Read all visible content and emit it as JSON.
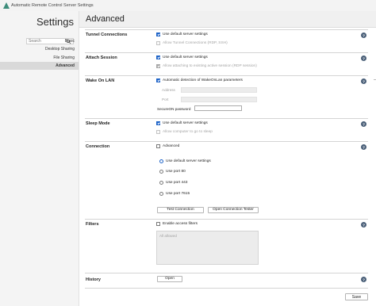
{
  "window": {
    "title": "Automatic Remote Control Server Settings"
  },
  "sidebar": {
    "heading": "Settings",
    "search": {
      "placeholder": "Search",
      "value": ""
    },
    "items": [
      {
        "label": "Basic"
      },
      {
        "label": "Desktop Sharing"
      },
      {
        "label": "File Sharing"
      },
      {
        "label": "Advanced",
        "active": true
      }
    ]
  },
  "main": {
    "title": "Advanced",
    "tunnel": {
      "label": "Tunnel Connections",
      "use_default": {
        "label": "Use default server settings",
        "checked": true
      },
      "allow_tunnel": {
        "label": "Allow Tunnel Connections (RDP, SSH)",
        "checked": false,
        "disabled": true
      }
    },
    "attach": {
      "label": "Attach Session",
      "use_default": {
        "label": "Use default server settings",
        "checked": true
      },
      "allow_attach": {
        "label": "Allow attaching to existing active session (RDP session)",
        "checked": true,
        "disabled": true
      }
    },
    "wol": {
      "label": "Wake On LAN",
      "auto_detect": {
        "label": "Automatic detection of WakeOnLan parameters",
        "checked": true
      },
      "address_label": "Address",
      "address_value": "",
      "port_label": "Port",
      "port_value": "",
      "secureon_label": "SecureON password",
      "secureon_value": ""
    },
    "sleep": {
      "label": "Sleep Mode",
      "use_default": {
        "label": "Use default server settings",
        "checked": true
      },
      "allow_sleep": {
        "label": "Allow computer to go to sleep",
        "checked": false,
        "disabled": true
      }
    },
    "connection": {
      "label": "Connection",
      "advanced": {
        "label": "Advanced",
        "checked": false
      },
      "options": [
        {
          "label": "Use default server settings",
          "selected": true
        },
        {
          "label": "Use port 80",
          "selected": false
        },
        {
          "label": "Use port 443",
          "selected": false
        },
        {
          "label": "Use port 7615",
          "selected": false
        }
      ],
      "test_button": "Test Connection",
      "open_tester_button": "Open Connection Tester"
    },
    "filters": {
      "label": "Filters",
      "enable": {
        "label": "Enable access filters",
        "checked": false
      },
      "list_placeholder": "All allowed"
    },
    "history": {
      "label": "History",
      "open_button": "Open"
    },
    "save_button": "Save"
  },
  "colors": {
    "accent": "#1e64c8",
    "help_icon": "#4a5f78",
    "sidebar_bg": "#f4f4f4",
    "active_item_bg": "#d9d9d9",
    "logo": "#3d8c7a"
  },
  "icons": {
    "help": "question-circle-icon",
    "search": "magnifier-icon",
    "app": "triangle-logo-icon"
  }
}
